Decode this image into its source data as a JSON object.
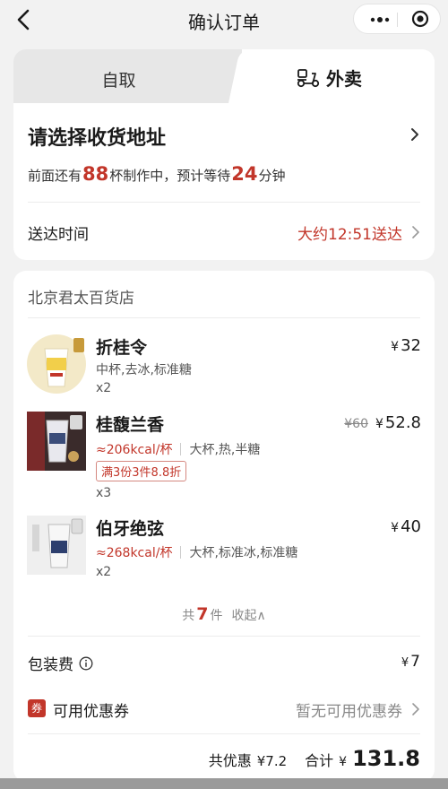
{
  "header": {
    "title": "确认订单",
    "more_icon": "more-dots-icon",
    "close_icon": "target-icon"
  },
  "tabs": {
    "pickup": "自取",
    "delivery": "外卖"
  },
  "address": {
    "prompt": "请选择收货地址"
  },
  "queue": {
    "prefix": "前面还有",
    "cups": "88",
    "middle": "杯制作中，预计等待",
    "minutes": "24",
    "suffix": "分钟"
  },
  "delivery_time": {
    "label": "送达时间",
    "value": "大约12:51送达"
  },
  "store": {
    "name": "北京君太百货店"
  },
  "items": [
    {
      "name": "折桂令",
      "price_yen": "¥",
      "price": "32",
      "spec": "中杯,去冰,标准糖",
      "qty": "x2"
    },
    {
      "name": "桂馥兰香",
      "old_price": "¥60",
      "price_yen": "¥",
      "price": "52.8",
      "kcal": "≈206kcal/杯",
      "spec": "大杯,热,半糖",
      "promo": "满3份3件8.8折",
      "qty": "x3"
    },
    {
      "name": "伯牙绝弦",
      "price_yen": "¥",
      "price": "40",
      "kcal": "≈268kcal/杯",
      "spec": "大杯,标准冰,标准糖",
      "qty": "x2"
    }
  ],
  "count": {
    "prefix": "共",
    "num": "7",
    "suffix": "件",
    "fold": "收起∧"
  },
  "packing": {
    "label": "包装费",
    "yen": "¥",
    "value": "7"
  },
  "coupon": {
    "badge": "券",
    "label": "可用优惠券",
    "value": "暂无可用优惠券"
  },
  "summary": {
    "discount_label": "共优惠",
    "discount_value": "¥7.2",
    "total_label": "合计",
    "yen": "¥",
    "total": "131.8"
  },
  "colors": {
    "accent": "#c2362a",
    "background": "#f2f2f2"
  }
}
